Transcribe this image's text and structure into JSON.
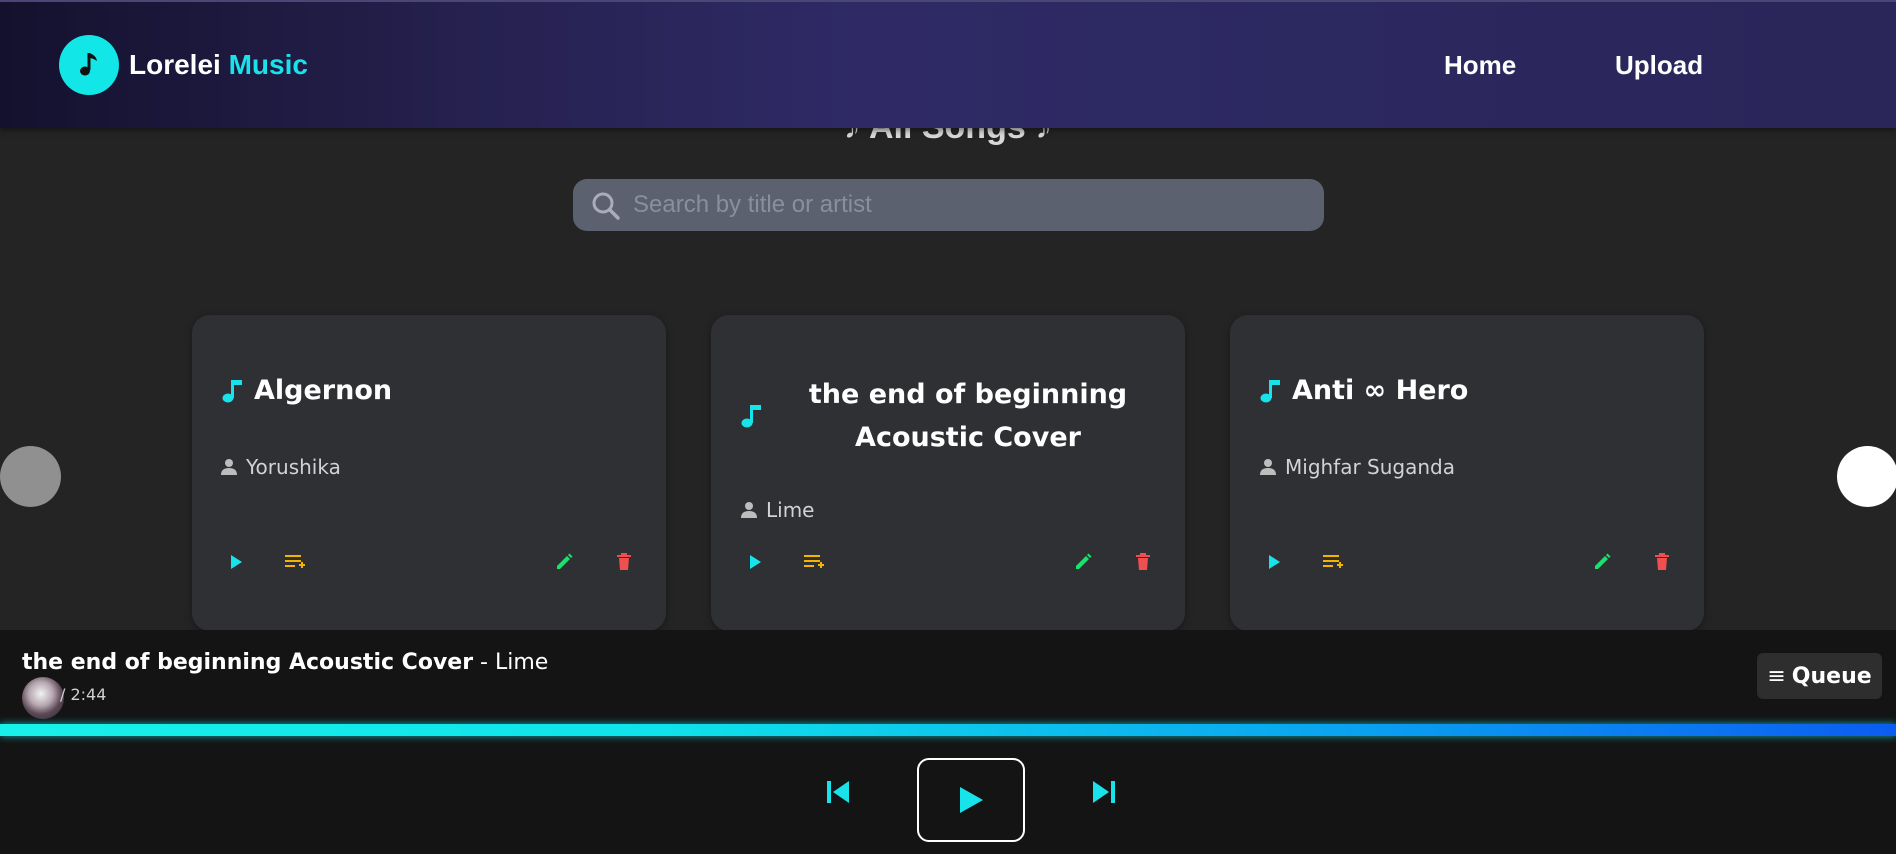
{
  "navbar": {
    "brand_main": "Lorelei",
    "brand_accent": "Music",
    "links": [
      "Home",
      "Upload"
    ]
  },
  "page": {
    "heading": "♪ All Songs ♪"
  },
  "search": {
    "placeholder": "Search by title or artist",
    "value": ""
  },
  "cards": [
    {
      "title": "Algernon",
      "artist": "Yorushika"
    },
    {
      "title": "the end of beginning Acoustic Cover",
      "artist": "Lime"
    },
    {
      "title": "Anti ∞ Hero",
      "artist": "Mighfar Suganda"
    }
  ],
  "player": {
    "song": "the end of beginning Acoustic Cover",
    "separator": " - ",
    "artist": "Lime",
    "time": "/ 2:44",
    "queue_label": "Queue",
    "queue_glyph": "≡",
    "progress": 1.0
  },
  "colors": {
    "accent": "#19e3ea",
    "queue_icon": "#f5b400",
    "edit_icon": "#19e36c",
    "delete_icon": "#ef4f4f"
  },
  "icons": {
    "logo": "music-note-icon",
    "search": "search-icon",
    "card_title": "music-note-icon",
    "artist": "person-icon",
    "play": "play-icon",
    "add_queue": "playlist-add-icon",
    "edit": "pencil-icon",
    "delete": "trash-icon",
    "previous": "skip-previous-icon",
    "next": "skip-next-icon"
  }
}
